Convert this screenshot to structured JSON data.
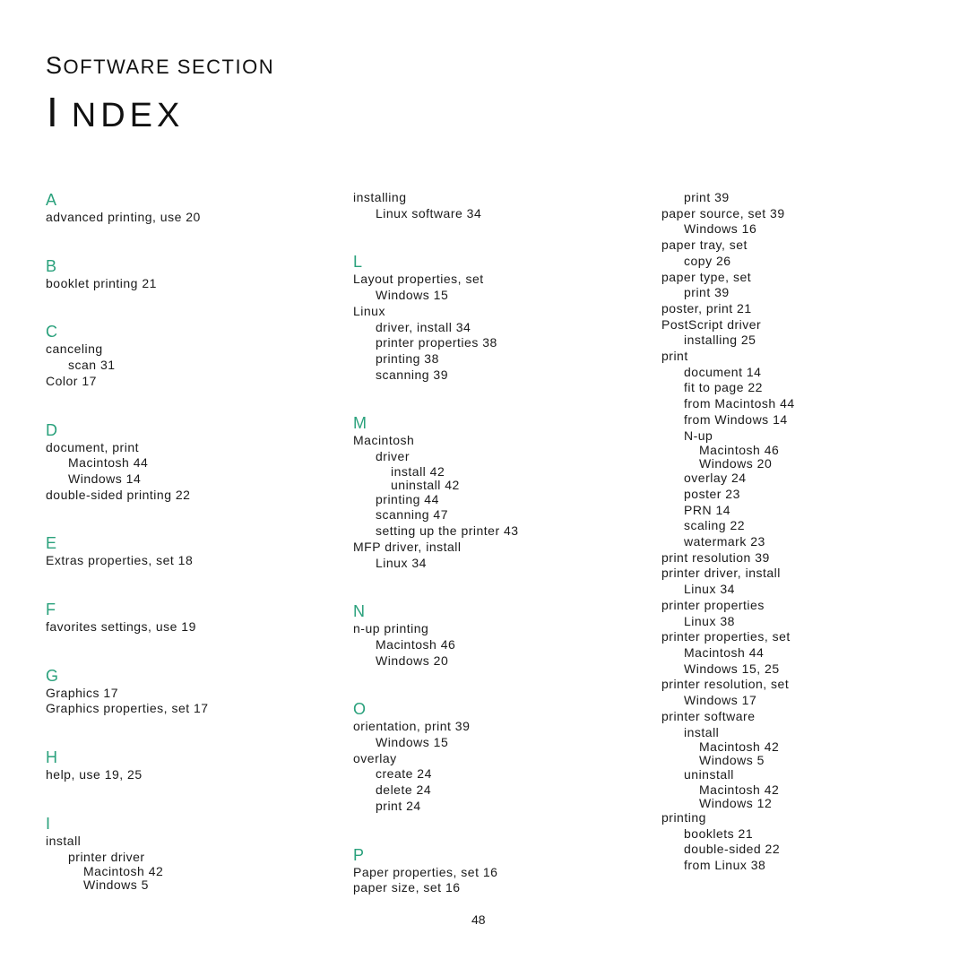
{
  "header": {
    "section_first": "S",
    "section_rest": "OFTWARE SECTION",
    "title_first": "I",
    "title_rest": "NDEX"
  },
  "accent_color": "#2aa17c",
  "page_number": "48",
  "columns": [
    [
      {
        "letter": "A",
        "entries": [
          {
            "level": 0,
            "text": "advanced printing, use 20"
          }
        ]
      },
      {
        "letter": "B",
        "entries": [
          {
            "level": 0,
            "text": "booklet printing 21"
          }
        ]
      },
      {
        "letter": "C",
        "entries": [
          {
            "level": 0,
            "text": "canceling"
          },
          {
            "level": 1,
            "text": "scan 31"
          },
          {
            "level": 0,
            "text": "Color 17"
          }
        ]
      },
      {
        "letter": "D",
        "entries": [
          {
            "level": 0,
            "text": "document, print"
          },
          {
            "level": 1,
            "text": "Macintosh 44"
          },
          {
            "level": 1,
            "text": "Windows 14"
          },
          {
            "level": 0,
            "text": "double-sided printing 22"
          }
        ]
      },
      {
        "letter": "E",
        "entries": [
          {
            "level": 0,
            "text": "Extras properties, set 18"
          }
        ]
      },
      {
        "letter": "F",
        "entries": [
          {
            "level": 0,
            "text": "favorites settings, use 19"
          }
        ]
      },
      {
        "letter": "G",
        "entries": [
          {
            "level": 0,
            "text": "Graphics 17"
          },
          {
            "level": 0,
            "text": "Graphics properties, set 17"
          }
        ]
      },
      {
        "letter": "H",
        "entries": [
          {
            "level": 0,
            "text": "help, use 19, 25"
          }
        ]
      },
      {
        "letter": "I",
        "entries": [
          {
            "level": 0,
            "text": "install"
          },
          {
            "level": 1,
            "text": "printer driver"
          },
          {
            "level": 2,
            "text": "Macintosh 42"
          },
          {
            "level": 2,
            "text": "Windows 5"
          }
        ]
      }
    ],
    [
      {
        "letter": "",
        "entries": [
          {
            "level": 0,
            "text": "installing"
          },
          {
            "level": 1,
            "text": "Linux software 34"
          }
        ]
      },
      {
        "letter": "L",
        "entries": [
          {
            "level": 0,
            "text": "Layout properties, set"
          },
          {
            "level": 1,
            "text": "Windows 15"
          },
          {
            "level": 0,
            "text": "Linux"
          },
          {
            "level": 1,
            "text": "driver, install 34"
          },
          {
            "level": 1,
            "text": "printer properties 38"
          },
          {
            "level": 1,
            "text": "printing 38"
          },
          {
            "level": 1,
            "text": "scanning 39"
          }
        ]
      },
      {
        "letter": "M",
        "entries": [
          {
            "level": 0,
            "text": "Macintosh"
          },
          {
            "level": 1,
            "text": "driver"
          },
          {
            "level": 2,
            "text": "install 42"
          },
          {
            "level": 2,
            "text": "uninstall 42"
          },
          {
            "level": 1,
            "text": "printing 44"
          },
          {
            "level": 1,
            "text": "scanning 47"
          },
          {
            "level": 1,
            "text": "setting up the printer 43"
          },
          {
            "level": 0,
            "text": "MFP driver, install"
          },
          {
            "level": 1,
            "text": "Linux 34"
          }
        ]
      },
      {
        "letter": "N",
        "entries": [
          {
            "level": 0,
            "text": "n-up printing"
          },
          {
            "level": 1,
            "text": "Macintosh 46"
          },
          {
            "level": 1,
            "text": "Windows 20"
          }
        ]
      },
      {
        "letter": "O",
        "entries": [
          {
            "level": 0,
            "text": "orientation, print 39"
          },
          {
            "level": 1,
            "text": "Windows 15"
          },
          {
            "level": 0,
            "text": "overlay"
          },
          {
            "level": 1,
            "text": "create 24"
          },
          {
            "level": 1,
            "text": "delete 24"
          },
          {
            "level": 1,
            "text": "print 24"
          }
        ]
      },
      {
        "letter": "P",
        "entries": [
          {
            "level": 0,
            "text": "Paper properties, set 16"
          },
          {
            "level": 0,
            "text": "paper size, set 16"
          }
        ]
      }
    ],
    [
      {
        "letter": "",
        "entries": [
          {
            "level": 1,
            "text": "print 39"
          },
          {
            "level": 0,
            "text": "paper source, set 39"
          },
          {
            "level": 1,
            "text": "Windows 16"
          },
          {
            "level": 0,
            "text": "paper tray, set"
          },
          {
            "level": 1,
            "text": "copy 26"
          },
          {
            "level": 0,
            "text": "paper type, set"
          },
          {
            "level": 1,
            "text": "print 39"
          },
          {
            "level": 0,
            "text": "poster, print 21"
          },
          {
            "level": 0,
            "text": "PostScript driver"
          },
          {
            "level": 1,
            "text": "installing 25"
          },
          {
            "level": 0,
            "text": "print"
          },
          {
            "level": 1,
            "text": "document 14"
          },
          {
            "level": 1,
            "text": "fit to page 22"
          },
          {
            "level": 1,
            "text": "from Macintosh 44"
          },
          {
            "level": 1,
            "text": "from Windows 14"
          },
          {
            "level": 1,
            "text": "N-up"
          },
          {
            "level": 2,
            "text": "Macintosh 46"
          },
          {
            "level": 2,
            "text": "Windows 20"
          },
          {
            "level": 1,
            "text": "overlay 24"
          },
          {
            "level": 1,
            "text": "poster 23"
          },
          {
            "level": 1,
            "text": "PRN 14"
          },
          {
            "level": 1,
            "text": "scaling 22"
          },
          {
            "level": 1,
            "text": "watermark 23"
          },
          {
            "level": 0,
            "text": "print resolution 39"
          },
          {
            "level": 0,
            "text": "printer driver, install"
          },
          {
            "level": 1,
            "text": "Linux 34"
          },
          {
            "level": 0,
            "text": "printer properties"
          },
          {
            "level": 1,
            "text": "Linux 38"
          },
          {
            "level": 0,
            "text": "printer properties, set"
          },
          {
            "level": 1,
            "text": "Macintosh 44"
          },
          {
            "level": 1,
            "text": "Windows 15, 25"
          },
          {
            "level": 0,
            "text": "printer resolution, set"
          },
          {
            "level": 1,
            "text": "Windows 17"
          },
          {
            "level": 0,
            "text": "printer software"
          },
          {
            "level": 1,
            "text": "install"
          },
          {
            "level": 2,
            "text": "Macintosh 42"
          },
          {
            "level": 2,
            "text": "Windows 5"
          },
          {
            "level": 1,
            "text": "uninstall"
          },
          {
            "level": 2,
            "text": "Macintosh 42"
          },
          {
            "level": 2,
            "text": "Windows 12"
          },
          {
            "level": 0,
            "text": "printing"
          },
          {
            "level": 1,
            "text": "booklets 21"
          },
          {
            "level": 1,
            "text": "double-sided 22"
          },
          {
            "level": 1,
            "text": "from Linux 38"
          }
        ]
      }
    ]
  ]
}
